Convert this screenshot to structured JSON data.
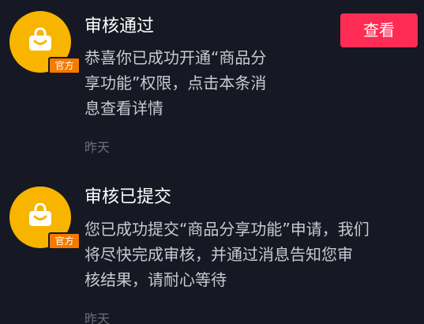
{
  "messages": [
    {
      "avatar_badge": "官方",
      "title": "审核通过",
      "body_lines": [
        "恭喜你已成功开通“商品分",
        "享功能”权限，点击本条消",
        "息查看详情"
      ],
      "time": "昨天",
      "action_label": "查看"
    },
    {
      "avatar_badge": "官方",
      "title": "审核已提交",
      "body_lines": [
        "您已成功提交“商品分享功能”申请，我们",
        "将尽快完成审核，并通过消息告知您审",
        "核结果，请耐心等待"
      ],
      "time": "昨天"
    }
  ],
  "colors": {
    "background": "#161823",
    "avatar": "#f7b500",
    "badge": "#f47a00",
    "action_button": "#fe2c55"
  },
  "icons": {
    "avatar_icon": "shopping-bag-smile-icon"
  }
}
